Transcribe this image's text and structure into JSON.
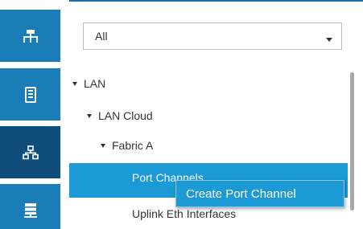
{
  "rail": {
    "items": [
      {
        "icon": "network-topology-icon"
      },
      {
        "icon": "server-icon"
      },
      {
        "icon": "lan-network-icon",
        "active": true
      },
      {
        "icon": "storage-icon"
      }
    ]
  },
  "filter": {
    "value": "All"
  },
  "tree": {
    "lan": "LAN",
    "lan_cloud": "LAN Cloud",
    "fabric_a": "Fabric A",
    "port_channels": "Port Channels",
    "uplink_eth": "Uplink Eth Interfaces"
  },
  "context_menu": {
    "create_port_channel": "Create Port Channel"
  },
  "colors": {
    "rail": "#1a7db8",
    "rail_active": "#0f4d7a",
    "selection": "#1c9ad6",
    "text": "#333333"
  }
}
